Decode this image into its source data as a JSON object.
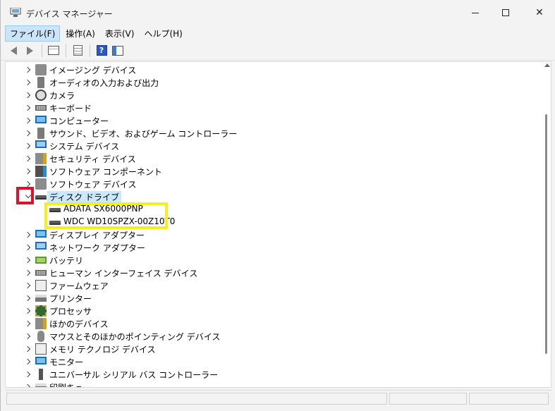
{
  "window": {
    "title": "デバイス マネージャー",
    "controls": {
      "minimize": "minimize",
      "maximize": "maximize",
      "close": "✕"
    }
  },
  "menu": [
    {
      "label": "ファイル(F)",
      "active": true
    },
    {
      "label": "操作(A)",
      "active": false
    },
    {
      "label": "表示(V)",
      "active": false
    },
    {
      "label": "ヘルプ(H)",
      "active": false
    }
  ],
  "toolbar": {
    "back_icon": "arrow-left-icon",
    "forward_icon": "arrow-right-icon",
    "help_glyph": "?"
  },
  "tree": {
    "categories": [
      {
        "label": "イメージング デバイス",
        "icon": "camera-imaging-icon",
        "expanded": false
      },
      {
        "label": "オーディオの入力および出力",
        "icon": "speaker-icon",
        "expanded": false
      },
      {
        "label": "カメラ",
        "icon": "camera-icon",
        "expanded": false
      },
      {
        "label": "キーボード",
        "icon": "keyboard-icon",
        "expanded": false
      },
      {
        "label": "コンピューター",
        "icon": "computer-icon",
        "expanded": false
      },
      {
        "label": "サウンド、ビデオ、およびゲーム コントローラー",
        "icon": "sound-icon",
        "expanded": false
      },
      {
        "label": "システム デバイス",
        "icon": "system-icon",
        "expanded": false
      },
      {
        "label": "セキュリティ デバイス",
        "icon": "security-icon",
        "expanded": false
      },
      {
        "label": "ソフトウェア コンポーネント",
        "icon": "software-component-icon",
        "expanded": false
      },
      {
        "label": "ソフトウェア デバイス",
        "icon": "software-device-icon",
        "expanded": false
      },
      {
        "label": "ディスク ドライブ",
        "icon": "disk-drive-icon",
        "expanded": true
      },
      {
        "label": "ディスプレイ アダプター",
        "icon": "display-adapter-icon",
        "expanded": false
      },
      {
        "label": "ネットワーク アダプター",
        "icon": "network-adapter-icon",
        "expanded": false
      },
      {
        "label": "バッテリ",
        "icon": "battery-icon",
        "expanded": false
      },
      {
        "label": "ヒューマン インターフェイス デバイス",
        "icon": "hid-icon",
        "expanded": false
      },
      {
        "label": "ファームウェア",
        "icon": "firmware-icon",
        "expanded": false
      },
      {
        "label": "プリンター",
        "icon": "printer-icon",
        "expanded": false
      },
      {
        "label": "プロセッサ",
        "icon": "processor-icon",
        "expanded": false
      },
      {
        "label": "ほかのデバイス",
        "icon": "other-devices-icon",
        "expanded": false
      },
      {
        "label": "マウスとそのほかのポインティング デバイス",
        "icon": "mouse-icon",
        "expanded": false
      },
      {
        "label": "メモリ テクノロジ デバイス",
        "icon": "memory-icon",
        "expanded": false
      },
      {
        "label": "モニター",
        "icon": "monitor-icon",
        "expanded": false
      },
      {
        "label": "ユニバーサル シリアル バス コントローラー",
        "icon": "usb-icon",
        "expanded": false
      },
      {
        "label": "印刷キュー",
        "icon": "print-queue-icon",
        "expanded": false
      }
    ],
    "disk_drives": [
      {
        "label": "ADATA SX6000PNP",
        "icon": "drive-icon"
      },
      {
        "label": "WDC WD10SPZX-00Z10T0",
        "icon": "drive-icon"
      }
    ]
  },
  "annotations": {
    "red_box_color": "#e0102a",
    "yellow_box_color": "#f6ef1a",
    "selection_color": "#cce8ff"
  }
}
